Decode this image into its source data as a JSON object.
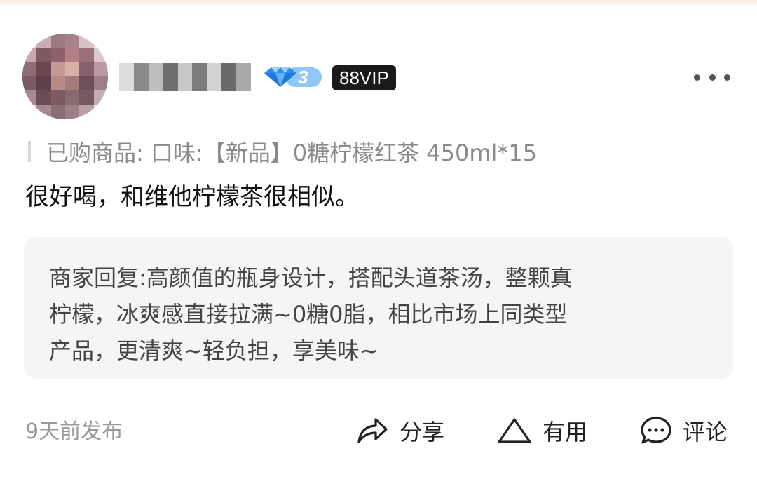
{
  "user": {
    "level": "3",
    "vip_badge": "88VIP"
  },
  "review": {
    "purchased_label": "已购商品:",
    "purchased_item": "口味:【新品】0糖柠檬红茶 450ml*15",
    "content": "很好喝，和维他柠檬茶很相似。"
  },
  "merchant_reply": {
    "lines": [
      "商家回复:高颜值的瓶身设计，搭配头道茶汤，整颗真",
      "柠檬，冰爽感直接拉满~0糖0脂，相比市场上同类型",
      "产品，更清爽~轻负担，享美味~"
    ]
  },
  "footer": {
    "timestamp": "9天前发布",
    "share_label": "分享",
    "useful_label": "有用",
    "comment_label": "评论"
  },
  "icons": {
    "more": "more-dots-icon",
    "diamond": "diamond-icon",
    "share": "share-arrow-icon",
    "useful": "triangle-useful-icon",
    "comment": "chat-bubble-icon"
  },
  "colors": {
    "diamond_blue": "#2f8ff0",
    "vip_bg": "#1a1a1a",
    "reply_bg": "#f5f5f5",
    "muted_text": "#8a8a8a"
  }
}
